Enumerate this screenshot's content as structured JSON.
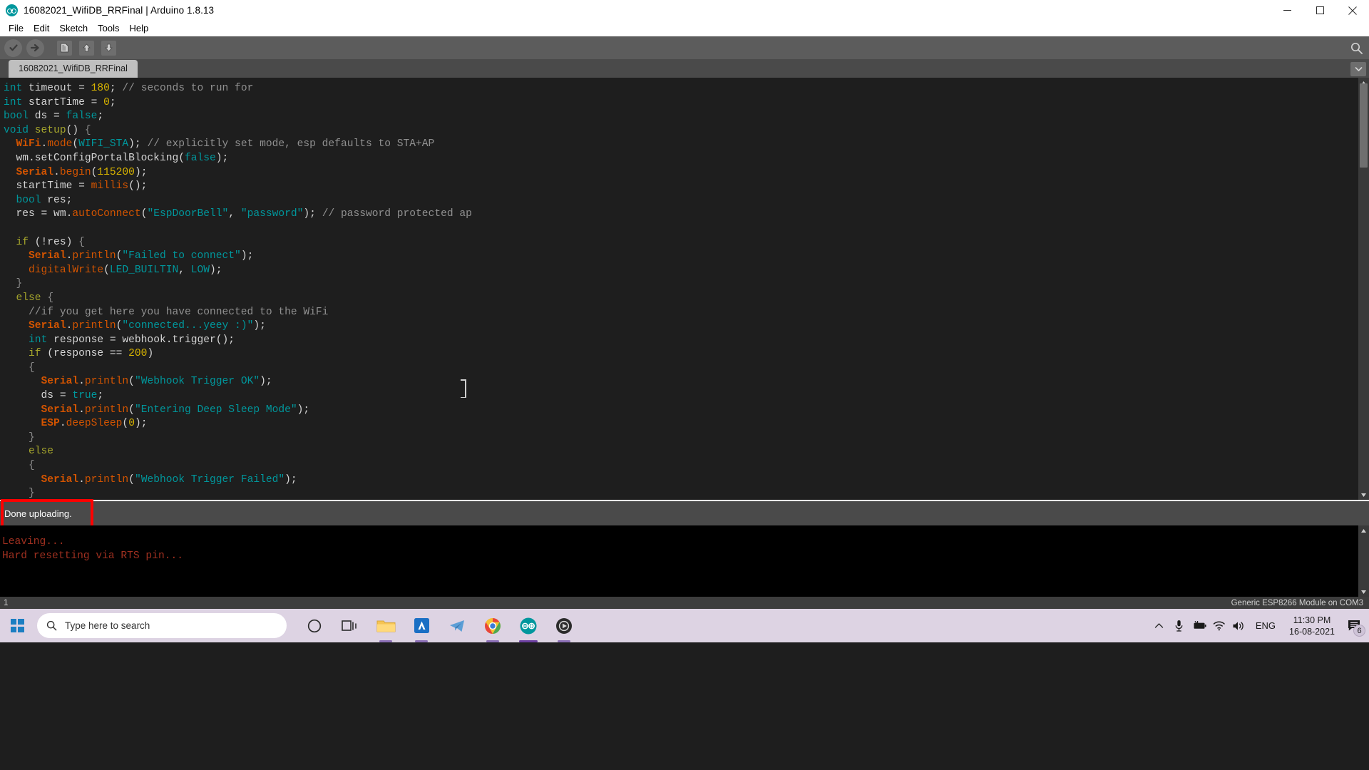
{
  "window": {
    "title": "16082021_WifiDB_RRFinal | Arduino 1.8.13",
    "minimize_label": "Minimize",
    "maximize_label": "Maximize",
    "close_label": "Close"
  },
  "menubar": {
    "items": [
      {
        "label": "File"
      },
      {
        "label": "Edit"
      },
      {
        "label": "Sketch"
      },
      {
        "label": "Tools"
      },
      {
        "label": "Help"
      }
    ]
  },
  "toolbar": {
    "verify_label": "Verify",
    "upload_label": "Upload",
    "new_label": "New",
    "open_label": "Open",
    "save_label": "Save",
    "serial_monitor_label": "Serial Monitor"
  },
  "tabs": {
    "active": "16082021_WifiDB_RRFinal",
    "menu_label": "Tab menu"
  },
  "editor": {
    "lines": [
      [
        {
          "t": "int",
          "c": "k-type"
        },
        {
          "t": " timeout = ",
          "c": "k-plain"
        },
        {
          "t": "180",
          "c": "k-num"
        },
        {
          "t": "; ",
          "c": "k-plain"
        },
        {
          "t": "// seconds to run for",
          "c": "k-cmt"
        }
      ],
      [
        {
          "t": "int",
          "c": "k-type"
        },
        {
          "t": " startTime = ",
          "c": "k-plain"
        },
        {
          "t": "0",
          "c": "k-num"
        },
        {
          "t": ";",
          "c": "k-plain"
        }
      ],
      [
        {
          "t": "bool",
          "c": "k-type"
        },
        {
          "t": " ds = ",
          "c": "k-plain"
        },
        {
          "t": "false",
          "c": "k-const"
        },
        {
          "t": ";",
          "c": "k-plain"
        }
      ],
      [
        {
          "t": "void",
          "c": "k-type"
        },
        {
          "t": " ",
          "c": "k-plain"
        },
        {
          "t": "setup",
          "c": "k-ctrl"
        },
        {
          "t": "() ",
          "c": "k-plain"
        },
        {
          "t": "{",
          "c": "k-brace"
        }
      ],
      [
        {
          "t": "  ",
          "c": "k-plain"
        },
        {
          "t": "WiFi",
          "c": "k-obj"
        },
        {
          "t": ".",
          "c": "k-plain"
        },
        {
          "t": "mode",
          "c": "k-fn"
        },
        {
          "t": "(",
          "c": "k-plain"
        },
        {
          "t": "WIFI_STA",
          "c": "k-const"
        },
        {
          "t": "); ",
          "c": "k-plain"
        },
        {
          "t": "// explicitly set mode, esp defaults to STA+AP",
          "c": "k-cmt"
        }
      ],
      [
        {
          "t": "  wm.setConfigPortalBlocking(",
          "c": "k-plain"
        },
        {
          "t": "false",
          "c": "k-const"
        },
        {
          "t": ");",
          "c": "k-plain"
        }
      ],
      [
        {
          "t": "  ",
          "c": "k-plain"
        },
        {
          "t": "Serial",
          "c": "k-obj"
        },
        {
          "t": ".",
          "c": "k-plain"
        },
        {
          "t": "begin",
          "c": "k-fn"
        },
        {
          "t": "(",
          "c": "k-plain"
        },
        {
          "t": "115200",
          "c": "k-num"
        },
        {
          "t": ");",
          "c": "k-plain"
        }
      ],
      [
        {
          "t": "  startTime = ",
          "c": "k-plain"
        },
        {
          "t": "millis",
          "c": "k-fn"
        },
        {
          "t": "();",
          "c": "k-plain"
        }
      ],
      [
        {
          "t": "  ",
          "c": "k-plain"
        },
        {
          "t": "bool",
          "c": "k-type"
        },
        {
          "t": " res;",
          "c": "k-plain"
        }
      ],
      [
        {
          "t": "  res = wm.",
          "c": "k-plain"
        },
        {
          "t": "autoConnect",
          "c": "k-fn"
        },
        {
          "t": "(",
          "c": "k-plain"
        },
        {
          "t": "\"EspDoorBell\"",
          "c": "k-str"
        },
        {
          "t": ", ",
          "c": "k-plain"
        },
        {
          "t": "\"password\"",
          "c": "k-str"
        },
        {
          "t": "); ",
          "c": "k-plain"
        },
        {
          "t": "// password protected ap",
          "c": "k-cmt"
        }
      ],
      [],
      [
        {
          "t": "  ",
          "c": "k-plain"
        },
        {
          "t": "if",
          "c": "k-ctrl"
        },
        {
          "t": " (!res) ",
          "c": "k-plain"
        },
        {
          "t": "{",
          "c": "k-brace"
        }
      ],
      [
        {
          "t": "    ",
          "c": "k-plain"
        },
        {
          "t": "Serial",
          "c": "k-obj"
        },
        {
          "t": ".",
          "c": "k-plain"
        },
        {
          "t": "println",
          "c": "k-fn"
        },
        {
          "t": "(",
          "c": "k-plain"
        },
        {
          "t": "\"Failed to connect\"",
          "c": "k-str"
        },
        {
          "t": ");",
          "c": "k-plain"
        }
      ],
      [
        {
          "t": "    ",
          "c": "k-plain"
        },
        {
          "t": "digitalWrite",
          "c": "k-fn"
        },
        {
          "t": "(",
          "c": "k-plain"
        },
        {
          "t": "LED_BUILTIN",
          "c": "k-const"
        },
        {
          "t": ", ",
          "c": "k-plain"
        },
        {
          "t": "LOW",
          "c": "k-const"
        },
        {
          "t": ");",
          "c": "k-plain"
        }
      ],
      [
        {
          "t": "  ",
          "c": "k-plain"
        },
        {
          "t": "}",
          "c": "k-brace"
        }
      ],
      [
        {
          "t": "  ",
          "c": "k-plain"
        },
        {
          "t": "else",
          "c": "k-ctrl"
        },
        {
          "t": " ",
          "c": "k-plain"
        },
        {
          "t": "{",
          "c": "k-brace"
        }
      ],
      [
        {
          "t": "    ",
          "c": "k-plain"
        },
        {
          "t": "//if you get here you have connected to the WiFi",
          "c": "k-cmt"
        }
      ],
      [
        {
          "t": "    ",
          "c": "k-plain"
        },
        {
          "t": "Serial",
          "c": "k-obj"
        },
        {
          "t": ".",
          "c": "k-plain"
        },
        {
          "t": "println",
          "c": "k-fn"
        },
        {
          "t": "(",
          "c": "k-plain"
        },
        {
          "t": "\"connected...yeey :)\"",
          "c": "k-str"
        },
        {
          "t": ");",
          "c": "k-plain"
        }
      ],
      [
        {
          "t": "    ",
          "c": "k-plain"
        },
        {
          "t": "int",
          "c": "k-type"
        },
        {
          "t": " response = webhook.trigger();",
          "c": "k-plain"
        }
      ],
      [
        {
          "t": "    ",
          "c": "k-plain"
        },
        {
          "t": "if",
          "c": "k-ctrl"
        },
        {
          "t": " (response == ",
          "c": "k-plain"
        },
        {
          "t": "200",
          "c": "k-num"
        },
        {
          "t": ")",
          "c": "k-plain"
        }
      ],
      [
        {
          "t": "    ",
          "c": "k-plain"
        },
        {
          "t": "{",
          "c": "k-brace"
        }
      ],
      [
        {
          "t": "      ",
          "c": "k-plain"
        },
        {
          "t": "Serial",
          "c": "k-obj"
        },
        {
          "t": ".",
          "c": "k-plain"
        },
        {
          "t": "println",
          "c": "k-fn"
        },
        {
          "t": "(",
          "c": "k-plain"
        },
        {
          "t": "\"Webhook Trigger OK\"",
          "c": "k-str"
        },
        {
          "t": ");",
          "c": "k-plain"
        }
      ],
      [
        {
          "t": "      ds = ",
          "c": "k-plain"
        },
        {
          "t": "true",
          "c": "k-const"
        },
        {
          "t": ";",
          "c": "k-plain"
        }
      ],
      [
        {
          "t": "      ",
          "c": "k-plain"
        },
        {
          "t": "Serial",
          "c": "k-obj"
        },
        {
          "t": ".",
          "c": "k-plain"
        },
        {
          "t": "println",
          "c": "k-fn"
        },
        {
          "t": "(",
          "c": "k-plain"
        },
        {
          "t": "\"Entering Deep Sleep Mode\"",
          "c": "k-str"
        },
        {
          "t": ");",
          "c": "k-plain"
        }
      ],
      [
        {
          "t": "      ",
          "c": "k-plain"
        },
        {
          "t": "ESP",
          "c": "k-obj"
        },
        {
          "t": ".",
          "c": "k-plain"
        },
        {
          "t": "deepSleep",
          "c": "k-fn"
        },
        {
          "t": "(",
          "c": "k-plain"
        },
        {
          "t": "0",
          "c": "k-num"
        },
        {
          "t": ");",
          "c": "k-plain"
        }
      ],
      [
        {
          "t": "    ",
          "c": "k-plain"
        },
        {
          "t": "}",
          "c": "k-brace"
        }
      ],
      [
        {
          "t": "    ",
          "c": "k-plain"
        },
        {
          "t": "else",
          "c": "k-ctrl"
        }
      ],
      [
        {
          "t": "    ",
          "c": "k-plain"
        },
        {
          "t": "{",
          "c": "k-brace"
        }
      ],
      [
        {
          "t": "      ",
          "c": "k-plain"
        },
        {
          "t": "Serial",
          "c": "k-obj"
        },
        {
          "t": ".",
          "c": "k-plain"
        },
        {
          "t": "println",
          "c": "k-fn"
        },
        {
          "t": "(",
          "c": "k-plain"
        },
        {
          "t": "\"Webhook Trigger Failed\"",
          "c": "k-str"
        },
        {
          "t": ");",
          "c": "k-plain"
        }
      ],
      [
        {
          "t": "    ",
          "c": "k-plain"
        },
        {
          "t": "}",
          "c": "k-brace"
        }
      ]
    ]
  },
  "status": {
    "message": "Done uploading.",
    "highlight_color": "#ff0000"
  },
  "console": {
    "lines": [
      "Leaving...",
      "Hard resetting via RTS pin..."
    ],
    "text_color": "#a03020"
  },
  "ide_status": {
    "line_number": "1",
    "board": "Generic ESP8266 Module on COM3"
  },
  "taskbar": {
    "start_label": "Start",
    "search_placeholder": "Type here to search",
    "items": [
      {
        "name": "cortana",
        "label": "Cortana"
      },
      {
        "name": "task-view",
        "label": "Task View"
      },
      {
        "name": "file-explorer",
        "label": "File Explorer"
      },
      {
        "name": "autocad",
        "label": "AutoCAD"
      },
      {
        "name": "telegram",
        "label": "Telegram"
      },
      {
        "name": "chrome",
        "label": "Google Chrome"
      },
      {
        "name": "arduino",
        "label": "Arduino IDE"
      },
      {
        "name": "media-player",
        "label": "Media Player"
      }
    ],
    "tray": {
      "show_hidden_label": "Show hidden icons",
      "microphone_label": "Microphone",
      "battery_label": "Battery",
      "network_label": "Network",
      "volume_label": "Volume",
      "language": "ENG",
      "time": "11:30 PM",
      "date": "16-08-2021",
      "notification_count": "6"
    }
  }
}
